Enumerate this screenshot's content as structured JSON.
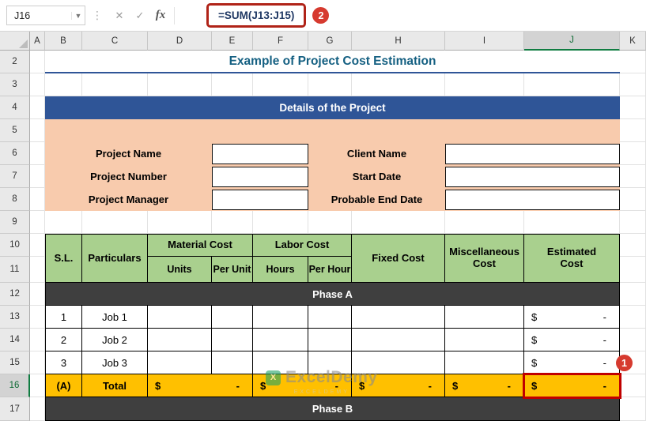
{
  "formula_bar": {
    "cell_reference": "J16",
    "formula": "=SUM(J13:J15)",
    "cancel_label": "✕",
    "enter_label": "✓",
    "fx_label": "fx"
  },
  "annotations": {
    "badge_formula": "2",
    "badge_cell": "1"
  },
  "sheet": {
    "column_headers": [
      "A",
      "B",
      "C",
      "D",
      "E",
      "F",
      "G",
      "H",
      "I",
      "J",
      "K"
    ],
    "row_headers": [
      "2",
      "3",
      "4",
      "5",
      "6",
      "7",
      "8",
      "9",
      "10",
      "11",
      "12",
      "13",
      "14",
      "15",
      "16",
      "17"
    ],
    "selected_cell": "J16"
  },
  "content": {
    "title": "Example of Project Cost Estimation",
    "details_banner": "Details of the Project",
    "fields_left": [
      {
        "label": "Project Name",
        "value": ""
      },
      {
        "label": "Project Number",
        "value": ""
      },
      {
        "label": "Project Manager",
        "value": ""
      }
    ],
    "fields_right": [
      {
        "label": "Client Name",
        "value": ""
      },
      {
        "label": "Start Date",
        "value": ""
      },
      {
        "label": "Probable End Date",
        "value": ""
      }
    ],
    "table": {
      "headers": {
        "sl": "S.L.",
        "particulars": "Particulars",
        "material_cost": "Material Cost",
        "units": "Units",
        "per_unit": "Per Unit",
        "labor_cost": "Labor Cost",
        "hours": "Hours",
        "per_hour": "Per Hour",
        "fixed_cost": "Fixed Cost",
        "miscellaneous_cost": "Miscellaneous Cost",
        "estimated_cost": "Estimated Cost"
      },
      "phase_a_label": "Phase A",
      "phase_b_label": "Phase B",
      "rows": [
        {
          "sl": "1",
          "particulars": "Job 1",
          "estimated_currency": "$",
          "estimated_amount": "-"
        },
        {
          "sl": "2",
          "particulars": "Job 2",
          "estimated_currency": "$",
          "estimated_amount": "-"
        },
        {
          "sl": "3",
          "particulars": "Job 3",
          "estimated_currency": "$",
          "estimated_amount": "-"
        }
      ],
      "total_row": {
        "sl": "(A)",
        "label": "Total",
        "currency": "$",
        "amount": "-"
      }
    }
  },
  "watermark": {
    "name": "ExcelDemy",
    "tagline": "EXCELDEMY"
  },
  "colors": {
    "title_text": "#156082",
    "details_banner_bg": "#2F5597",
    "details_bg": "#F8CBAD",
    "table_header_bg": "#A9D08E",
    "phase_banner_bg": "#3F3F3F",
    "total_row_bg": "#FFC000",
    "annotation_red": "#C00000",
    "selection_green": "#107C41"
  }
}
